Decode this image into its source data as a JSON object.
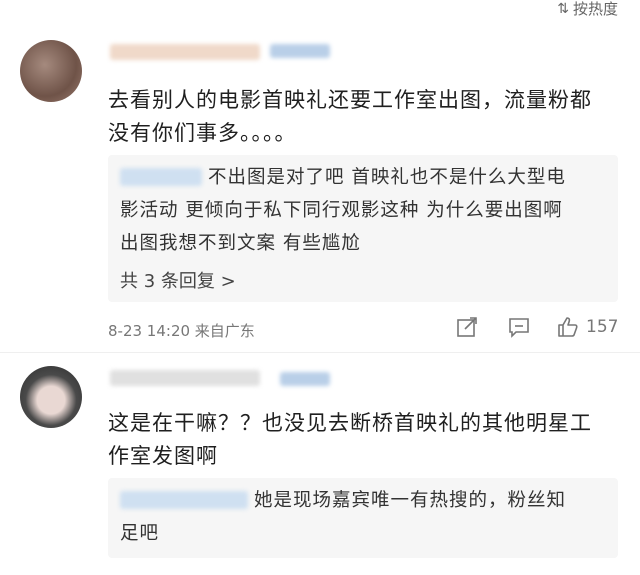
{
  "sort": {
    "label": "按热度",
    "icon": "sort-icon"
  },
  "comments": [
    {
      "text_line1": "去看别人的电影首映礼还要工作室出图，流量粉都",
      "text_line2": "没有你们事多。。。。",
      "reply": {
        "line1": "不出图是对了吧 首映礼也不是什么大型电",
        "line2": "影活动 更倾向于私下同行观影这种 为什么要出图啊",
        "line3": "出图我想不到文案 有些尴尬"
      },
      "more_replies": "共 3 条回复 >",
      "meta": "8-23 14:20 来自广东",
      "likes": "157"
    },
    {
      "text_line1": "这是在干嘛？？也没见去断桥首映礼的其他明星工",
      "text_line2": "作室发图啊",
      "reply": {
        "line1": "她是现场嘉宾唯一有热搜的，粉丝知",
        "line2": "足吧"
      }
    }
  ]
}
